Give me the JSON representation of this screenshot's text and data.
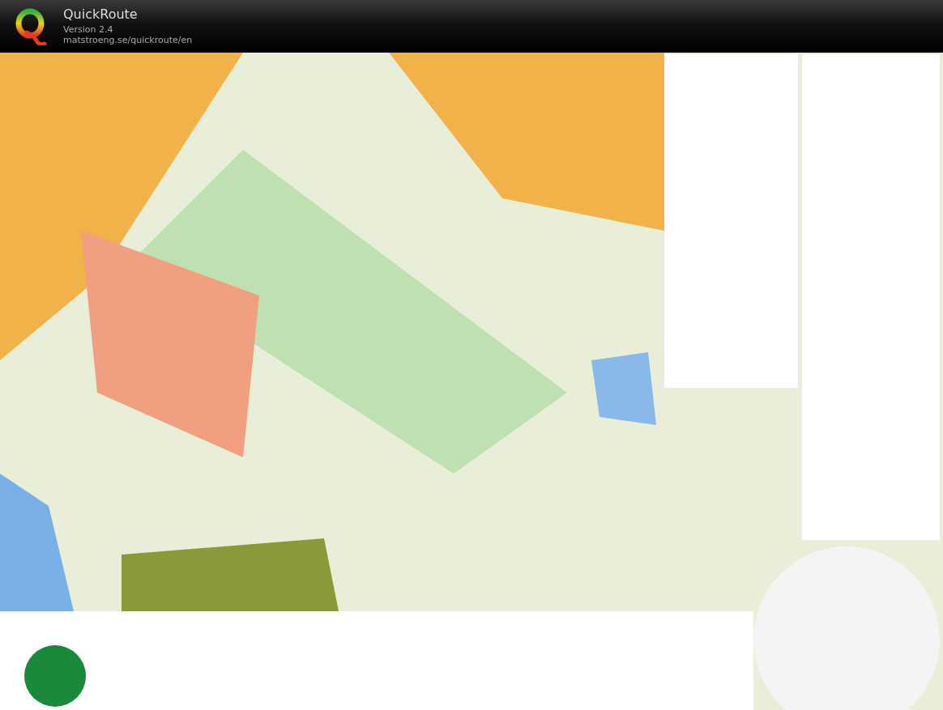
{
  "app": {
    "title": "QuickRoute",
    "version": "Version 2.4",
    "url": "matstroeng.se/quickroute/en"
  },
  "map": {
    "kind": "image"
  }
}
